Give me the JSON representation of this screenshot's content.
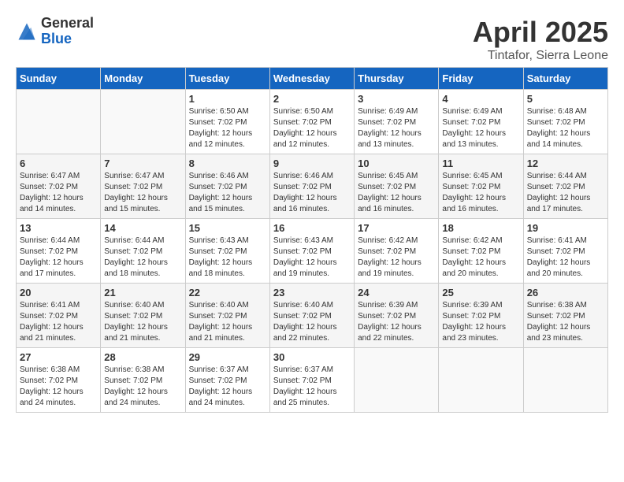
{
  "header": {
    "logo_general": "General",
    "logo_blue": "Blue",
    "month_title": "April 2025",
    "location": "Tintafor, Sierra Leone"
  },
  "days_of_week": [
    "Sunday",
    "Monday",
    "Tuesday",
    "Wednesday",
    "Thursday",
    "Friday",
    "Saturday"
  ],
  "weeks": [
    [
      {
        "day": "",
        "info": ""
      },
      {
        "day": "",
        "info": ""
      },
      {
        "day": "1",
        "info": "Sunrise: 6:50 AM\nSunset: 7:02 PM\nDaylight: 12 hours and 12 minutes."
      },
      {
        "day": "2",
        "info": "Sunrise: 6:50 AM\nSunset: 7:02 PM\nDaylight: 12 hours and 12 minutes."
      },
      {
        "day": "3",
        "info": "Sunrise: 6:49 AM\nSunset: 7:02 PM\nDaylight: 12 hours and 13 minutes."
      },
      {
        "day": "4",
        "info": "Sunrise: 6:49 AM\nSunset: 7:02 PM\nDaylight: 12 hours and 13 minutes."
      },
      {
        "day": "5",
        "info": "Sunrise: 6:48 AM\nSunset: 7:02 PM\nDaylight: 12 hours and 14 minutes."
      }
    ],
    [
      {
        "day": "6",
        "info": "Sunrise: 6:47 AM\nSunset: 7:02 PM\nDaylight: 12 hours and 14 minutes."
      },
      {
        "day": "7",
        "info": "Sunrise: 6:47 AM\nSunset: 7:02 PM\nDaylight: 12 hours and 15 minutes."
      },
      {
        "day": "8",
        "info": "Sunrise: 6:46 AM\nSunset: 7:02 PM\nDaylight: 12 hours and 15 minutes."
      },
      {
        "day": "9",
        "info": "Sunrise: 6:46 AM\nSunset: 7:02 PM\nDaylight: 12 hours and 16 minutes."
      },
      {
        "day": "10",
        "info": "Sunrise: 6:45 AM\nSunset: 7:02 PM\nDaylight: 12 hours and 16 minutes."
      },
      {
        "day": "11",
        "info": "Sunrise: 6:45 AM\nSunset: 7:02 PM\nDaylight: 12 hours and 16 minutes."
      },
      {
        "day": "12",
        "info": "Sunrise: 6:44 AM\nSunset: 7:02 PM\nDaylight: 12 hours and 17 minutes."
      }
    ],
    [
      {
        "day": "13",
        "info": "Sunrise: 6:44 AM\nSunset: 7:02 PM\nDaylight: 12 hours and 17 minutes."
      },
      {
        "day": "14",
        "info": "Sunrise: 6:44 AM\nSunset: 7:02 PM\nDaylight: 12 hours and 18 minutes."
      },
      {
        "day": "15",
        "info": "Sunrise: 6:43 AM\nSunset: 7:02 PM\nDaylight: 12 hours and 18 minutes."
      },
      {
        "day": "16",
        "info": "Sunrise: 6:43 AM\nSunset: 7:02 PM\nDaylight: 12 hours and 19 minutes."
      },
      {
        "day": "17",
        "info": "Sunrise: 6:42 AM\nSunset: 7:02 PM\nDaylight: 12 hours and 19 minutes."
      },
      {
        "day": "18",
        "info": "Sunrise: 6:42 AM\nSunset: 7:02 PM\nDaylight: 12 hours and 20 minutes."
      },
      {
        "day": "19",
        "info": "Sunrise: 6:41 AM\nSunset: 7:02 PM\nDaylight: 12 hours and 20 minutes."
      }
    ],
    [
      {
        "day": "20",
        "info": "Sunrise: 6:41 AM\nSunset: 7:02 PM\nDaylight: 12 hours and 21 minutes."
      },
      {
        "day": "21",
        "info": "Sunrise: 6:40 AM\nSunset: 7:02 PM\nDaylight: 12 hours and 21 minutes."
      },
      {
        "day": "22",
        "info": "Sunrise: 6:40 AM\nSunset: 7:02 PM\nDaylight: 12 hours and 21 minutes."
      },
      {
        "day": "23",
        "info": "Sunrise: 6:40 AM\nSunset: 7:02 PM\nDaylight: 12 hours and 22 minutes."
      },
      {
        "day": "24",
        "info": "Sunrise: 6:39 AM\nSunset: 7:02 PM\nDaylight: 12 hours and 22 minutes."
      },
      {
        "day": "25",
        "info": "Sunrise: 6:39 AM\nSunset: 7:02 PM\nDaylight: 12 hours and 23 minutes."
      },
      {
        "day": "26",
        "info": "Sunrise: 6:38 AM\nSunset: 7:02 PM\nDaylight: 12 hours and 23 minutes."
      }
    ],
    [
      {
        "day": "27",
        "info": "Sunrise: 6:38 AM\nSunset: 7:02 PM\nDaylight: 12 hours and 24 minutes."
      },
      {
        "day": "28",
        "info": "Sunrise: 6:38 AM\nSunset: 7:02 PM\nDaylight: 12 hours and 24 minutes."
      },
      {
        "day": "29",
        "info": "Sunrise: 6:37 AM\nSunset: 7:02 PM\nDaylight: 12 hours and 24 minutes."
      },
      {
        "day": "30",
        "info": "Sunrise: 6:37 AM\nSunset: 7:02 PM\nDaylight: 12 hours and 25 minutes."
      },
      {
        "day": "",
        "info": ""
      },
      {
        "day": "",
        "info": ""
      },
      {
        "day": "",
        "info": ""
      }
    ]
  ]
}
